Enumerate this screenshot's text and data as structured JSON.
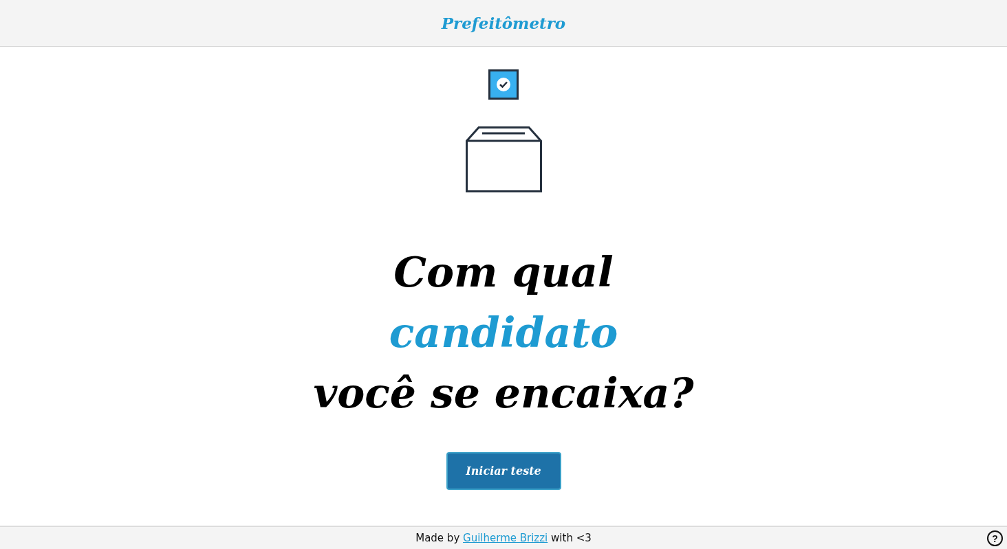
{
  "header": {
    "title": "Prefeitômetro"
  },
  "headline": [
    {
      "text": "Com qual",
      "highlight": false
    },
    {
      "text": "candidato",
      "highlight": true
    },
    {
      "text": "você se encaixa?",
      "highlight": false
    }
  ],
  "start_button": "Iniciar teste",
  "footer": {
    "before": "Made by ",
    "link": "Guilherme Brizzi",
    "after": " with <3",
    "help_button": "?"
  }
}
